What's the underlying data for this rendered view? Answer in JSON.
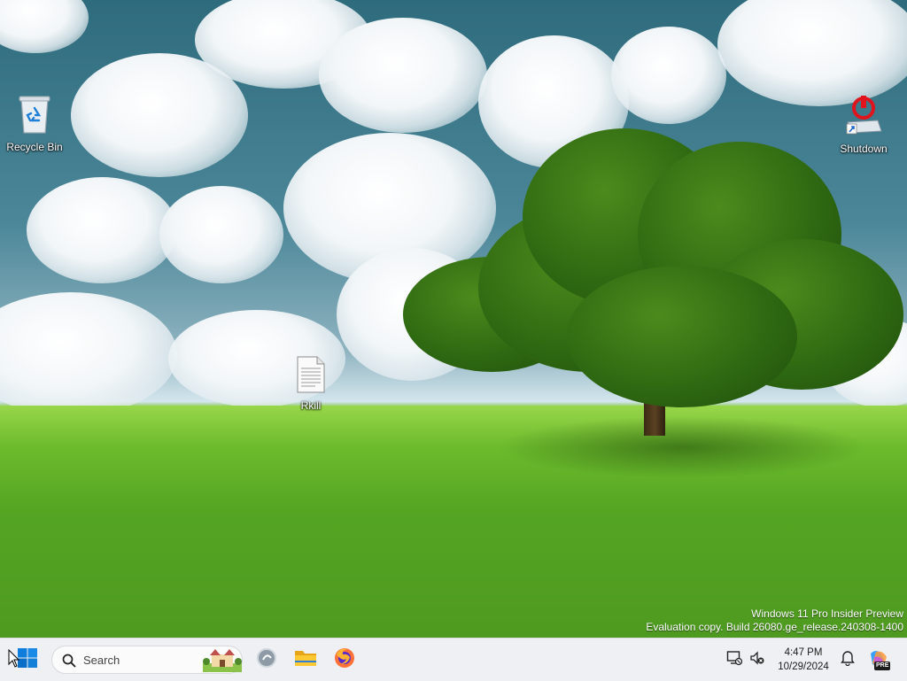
{
  "desktop": {
    "icons": [
      {
        "label": "Recycle Bin",
        "icon": "recycle-bin-icon"
      },
      {
        "label": "Shutdown",
        "icon": "shutdown-icon"
      },
      {
        "label": "Rkill",
        "icon": "text-file-icon"
      }
    ],
    "watermark": {
      "line1": "Windows 11 Pro Insider Preview",
      "line2": "Evaluation copy. Build 26080.ge_release.240308-1400"
    }
  },
  "taskbar": {
    "start_icon": "windows-start-icon",
    "search": {
      "label": "Search",
      "icon": "search-icon"
    },
    "apps": [
      {
        "name": "copilot",
        "icon": "copilot-icon"
      },
      {
        "name": "file-explorer",
        "icon": "folder-icon"
      },
      {
        "name": "firefox",
        "icon": "firefox-icon"
      }
    ],
    "tray": {
      "network_icon": "network-disconnected-icon",
      "sound_icon": "speaker-muted-icon",
      "time": "4:47 PM",
      "date": "10/29/2024",
      "notification_icon": "bell-icon",
      "badge": "PRE"
    },
    "accent": "#0078d4"
  }
}
